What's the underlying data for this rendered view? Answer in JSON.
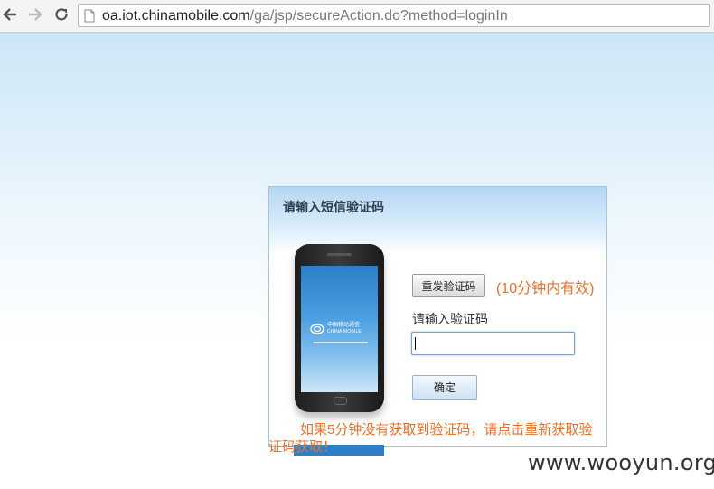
{
  "browser": {
    "url_host": "oa.iot.chinamobile.com",
    "url_path": "/ga/jsp/secureAction.do?method=loginIn"
  },
  "dialog": {
    "title": "请输入短信验证码",
    "resend_label": "重发验证码",
    "validity_text": "(10分钟内有效)",
    "code_label": "请输入验证码",
    "code_value": "",
    "confirm_label": "确定"
  },
  "phone": {
    "logo_cn": "中国移动通信",
    "logo_en": "CHINA MOBILE"
  },
  "notice": "如果5分钟没有获取到验证码，请点击重新获取验证码获取！",
  "watermark": "www.wooyun.org",
  "colors": {
    "accent_orange": "#e8702a",
    "dialog_border": "#9ec5e9",
    "brand_blue": "#2d7fc8"
  },
  "icons": [
    "back-arrow-icon",
    "forward-arrow-icon",
    "reload-icon",
    "page-icon",
    "china-mobile-logo-icon"
  ]
}
